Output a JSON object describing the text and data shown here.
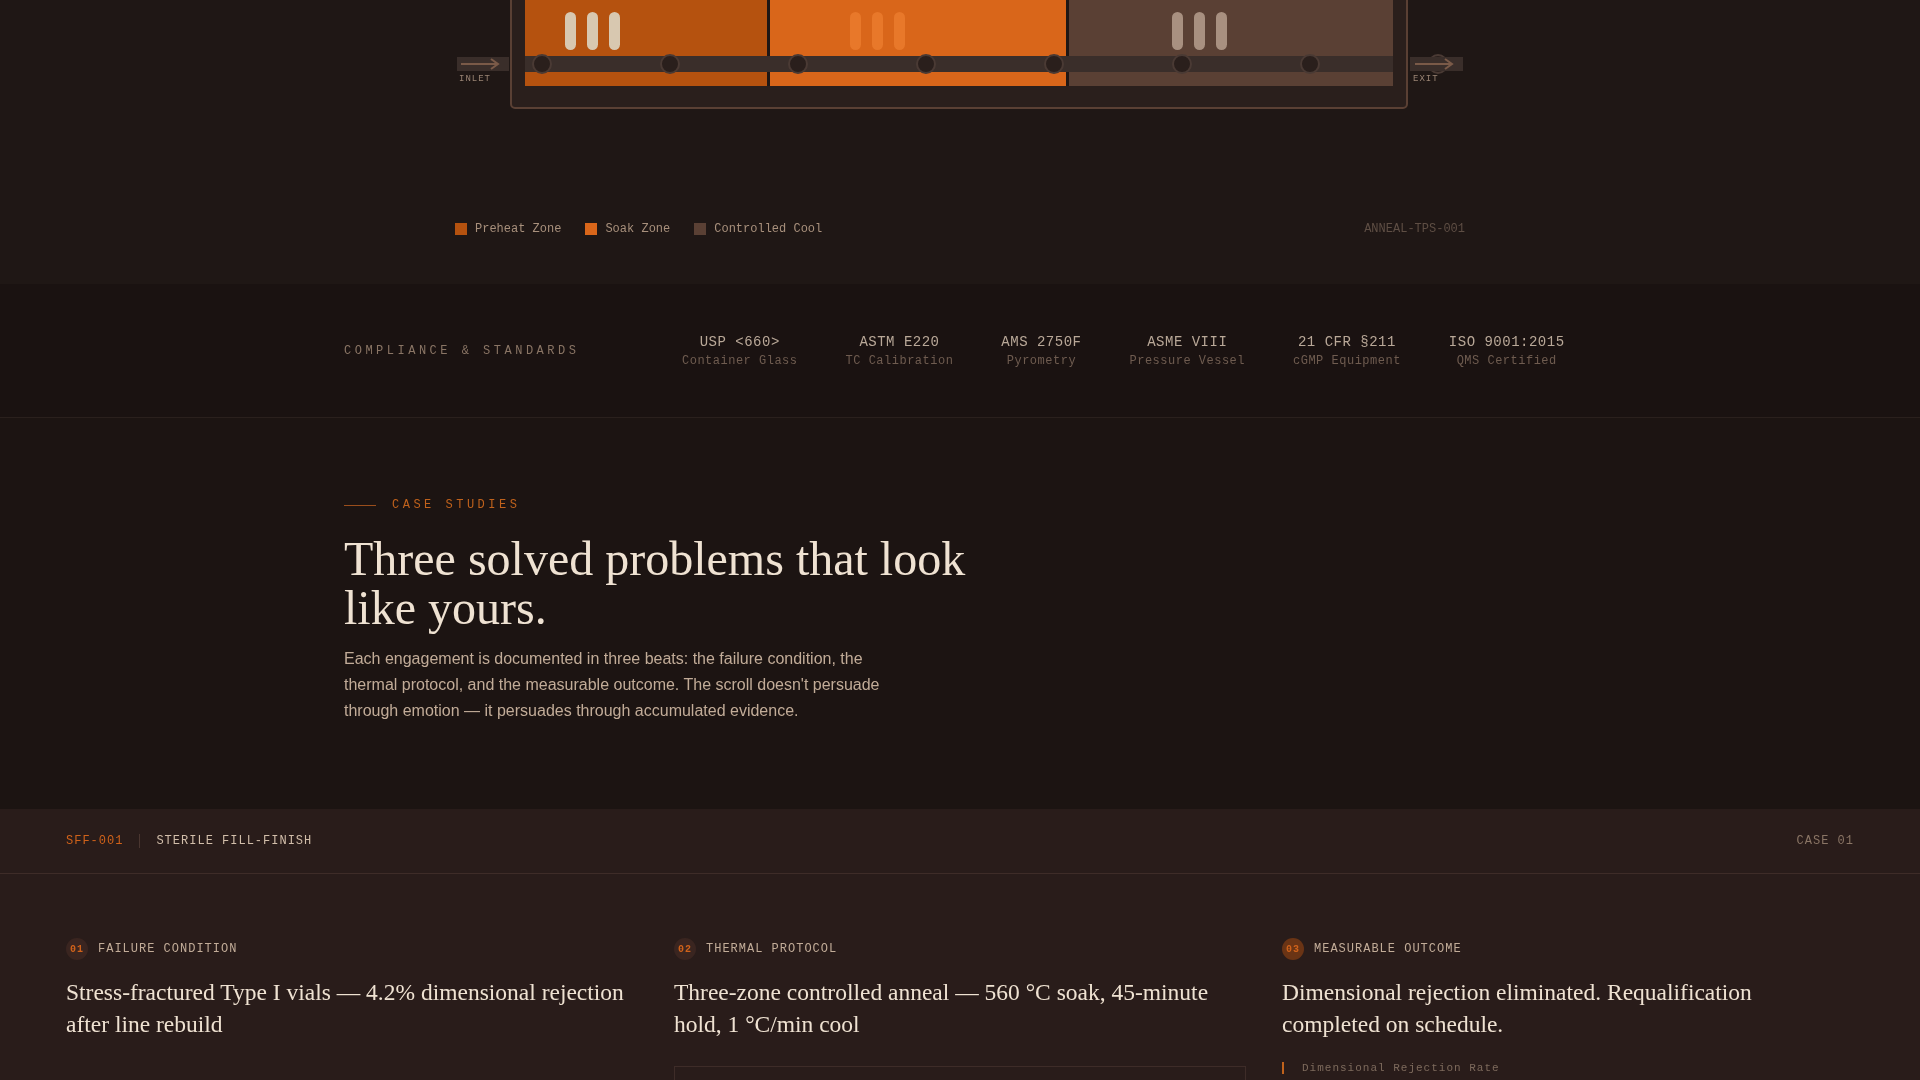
{
  "furnace": {
    "inlet_label": "INLET",
    "exit_label": "EXIT",
    "tag": "ANNEAL-TPS-001",
    "zones": [
      {
        "label": "Preheat Zone",
        "color": "#b5520f"
      },
      {
        "label": "Soak Zone",
        "color": "#d9661a"
      },
      {
        "label": "Controlled Cool",
        "color": "#5a4034"
      }
    ]
  },
  "compliance": {
    "label": "COMPLIANCE & STANDARDS",
    "standards": [
      {
        "code": "USP <660>",
        "desc": "Container Glass"
      },
      {
        "code": "ASTM E220",
        "desc": "TC Calibration"
      },
      {
        "code": "AMS 2750F",
        "desc": "Pyrometry"
      },
      {
        "code": "ASME VIII",
        "desc": "Pressure Vessel"
      },
      {
        "code": "21 CFR §211",
        "desc": "cGMP Equipment"
      },
      {
        "code": "ISO 9001:2015",
        "desc": "QMS Certified"
      }
    ]
  },
  "case_studies": {
    "eyebrow": "CASE STUDIES",
    "heading": "Three solved problems that look like yours.",
    "intro": "Each engagement is documented in three beats: the failure condition, the thermal protocol, and the measurable outcome. The scroll doesn't persuade through emotion — it persuades through accumulated evidence."
  },
  "case": {
    "id": "SFF-001",
    "category": "STERILE FILL-FINISH",
    "number": "CASE 01",
    "beats": [
      {
        "num": "01",
        "label": "FAILURE CONDITION",
        "title": "Stress-fractured Type I vials — 4.2% dimensional rejection after line rebuild",
        "selected": false
      },
      {
        "num": "02",
        "label": "THERMAL PROTOCOL",
        "title": "Three-zone controlled anneal — 560 °C soak, 45-minute hold, 1 °C/min cool",
        "selected": false
      },
      {
        "num": "03",
        "label": "MEASURABLE OUTCOME",
        "title": "Dimensional rejection eliminated. Requalification completed on schedule.",
        "selected": true
      }
    ],
    "metric_label": "Dimensional Rejection Rate"
  }
}
